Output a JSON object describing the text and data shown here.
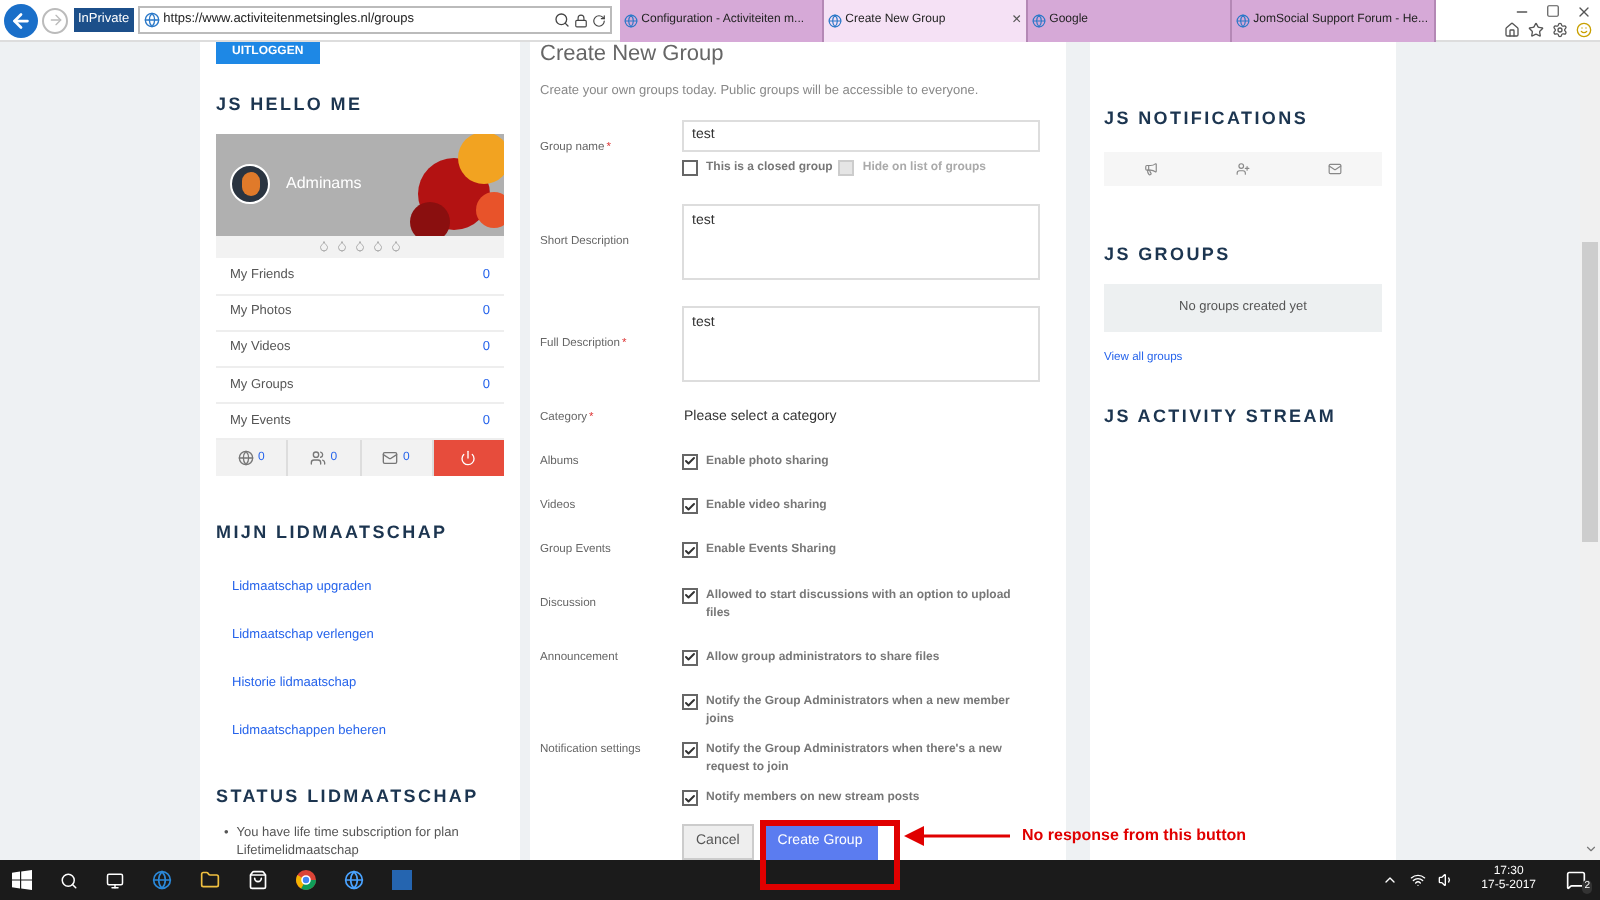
{
  "browser": {
    "inprivate": "InPrivate",
    "url": "https://www.activiteitenmetsingles.nl/groups",
    "tabs": [
      {
        "title": "Configuration - Activiteiten m...",
        "selected": false
      },
      {
        "title": "Create New Group",
        "selected": true,
        "close": "×"
      },
      {
        "title": "Google",
        "selected": false
      },
      {
        "title": "JomSocial Support Forum - He...",
        "selected": false
      }
    ]
  },
  "left": {
    "logout": "UITLOGGEN",
    "hello_title": "JS HELLO ME",
    "username": "Adminams",
    "stats": [
      {
        "label": "My Friends",
        "value": "0"
      },
      {
        "label": "My Photos",
        "value": "0"
      },
      {
        "label": "My Videos",
        "value": "0"
      },
      {
        "label": "My Groups",
        "value": "0"
      },
      {
        "label": "My Events",
        "value": "0"
      }
    ],
    "counters": [
      {
        "kind": "globe",
        "value": "0"
      },
      {
        "kind": "friends",
        "value": "0"
      },
      {
        "kind": "mail",
        "value": "0"
      }
    ],
    "membership_title": "MIJN LIDMAATSCHAP",
    "links": [
      "Lidmaatschap upgraden",
      "Lidmaatschap verlengen",
      "Historie lidmaatschap",
      "Lidmaatschappen beheren"
    ],
    "status_title": "STATUS LIDMAATSCHAP",
    "status_bullet": "•",
    "status_items": [
      "You have life time subscription for plan Lifetimelidmaatschap"
    ]
  },
  "form": {
    "required_mark": "*",
    "title": "Create New Group",
    "intro": "Create your own groups today. Public groups will be accessible to everyone.",
    "fields": [
      {
        "kind": "text",
        "label": "Group name",
        "required": true,
        "value": "test",
        "options": [
          {
            "label": "This is a closed group",
            "checked": false,
            "disabled": false
          },
          {
            "label": "Hide on list of groups",
            "checked": false,
            "disabled": true
          }
        ]
      },
      {
        "kind": "textarea",
        "label": "Short Description",
        "required": false,
        "value": "test"
      },
      {
        "kind": "textarea",
        "label": "Full Description",
        "required": true,
        "value": "test"
      },
      {
        "kind": "select",
        "label": "Category",
        "required": true,
        "value": "Please select a category"
      },
      {
        "kind": "checks",
        "label": "Albums",
        "required": false,
        "options": [
          {
            "label": "Enable photo sharing",
            "checked": true,
            "disabled": false
          }
        ]
      },
      {
        "kind": "checks",
        "label": "Videos",
        "required": false,
        "options": [
          {
            "label": "Enable video sharing",
            "checked": true,
            "disabled": false
          }
        ]
      },
      {
        "kind": "checks",
        "label": "Group Events",
        "required": false,
        "options": [
          {
            "label": "Enable Events Sharing",
            "checked": true,
            "disabled": false
          }
        ]
      },
      {
        "kind": "checks",
        "label": "Discussion",
        "required": false,
        "options": [
          {
            "label": "Allowed to start discussions with an option to upload files",
            "checked": true,
            "disabled": false
          }
        ]
      },
      {
        "kind": "checks",
        "label": "Announcement",
        "required": false,
        "options": [
          {
            "label": "Allow group administrators to share files",
            "checked": true,
            "disabled": false
          }
        ]
      },
      {
        "kind": "checks",
        "label": "Notification settings",
        "required": false,
        "options": [
          {
            "label": "Notify the Group Administrators when a new member joins",
            "checked": true,
            "disabled": false
          },
          {
            "label": "Notify the Group Administrators when there's a new request to join",
            "checked": true,
            "disabled": false
          },
          {
            "label": "Notify members on new stream posts",
            "checked": true,
            "disabled": false
          }
        ]
      }
    ],
    "cancel": "Cancel",
    "submit": "Create Group"
  },
  "right": {
    "notifications_title": "JS NOTIFICATIONS",
    "groups_title": "JS GROUPS",
    "groups_empty": "No groups created yet",
    "view_all": "View all groups",
    "activity_title": "JS ACTIVITY STREAM"
  },
  "annotation": "No response from this button",
  "taskbar": {
    "time": "17:30",
    "date": "17-5-2017",
    "notifications": "2"
  }
}
